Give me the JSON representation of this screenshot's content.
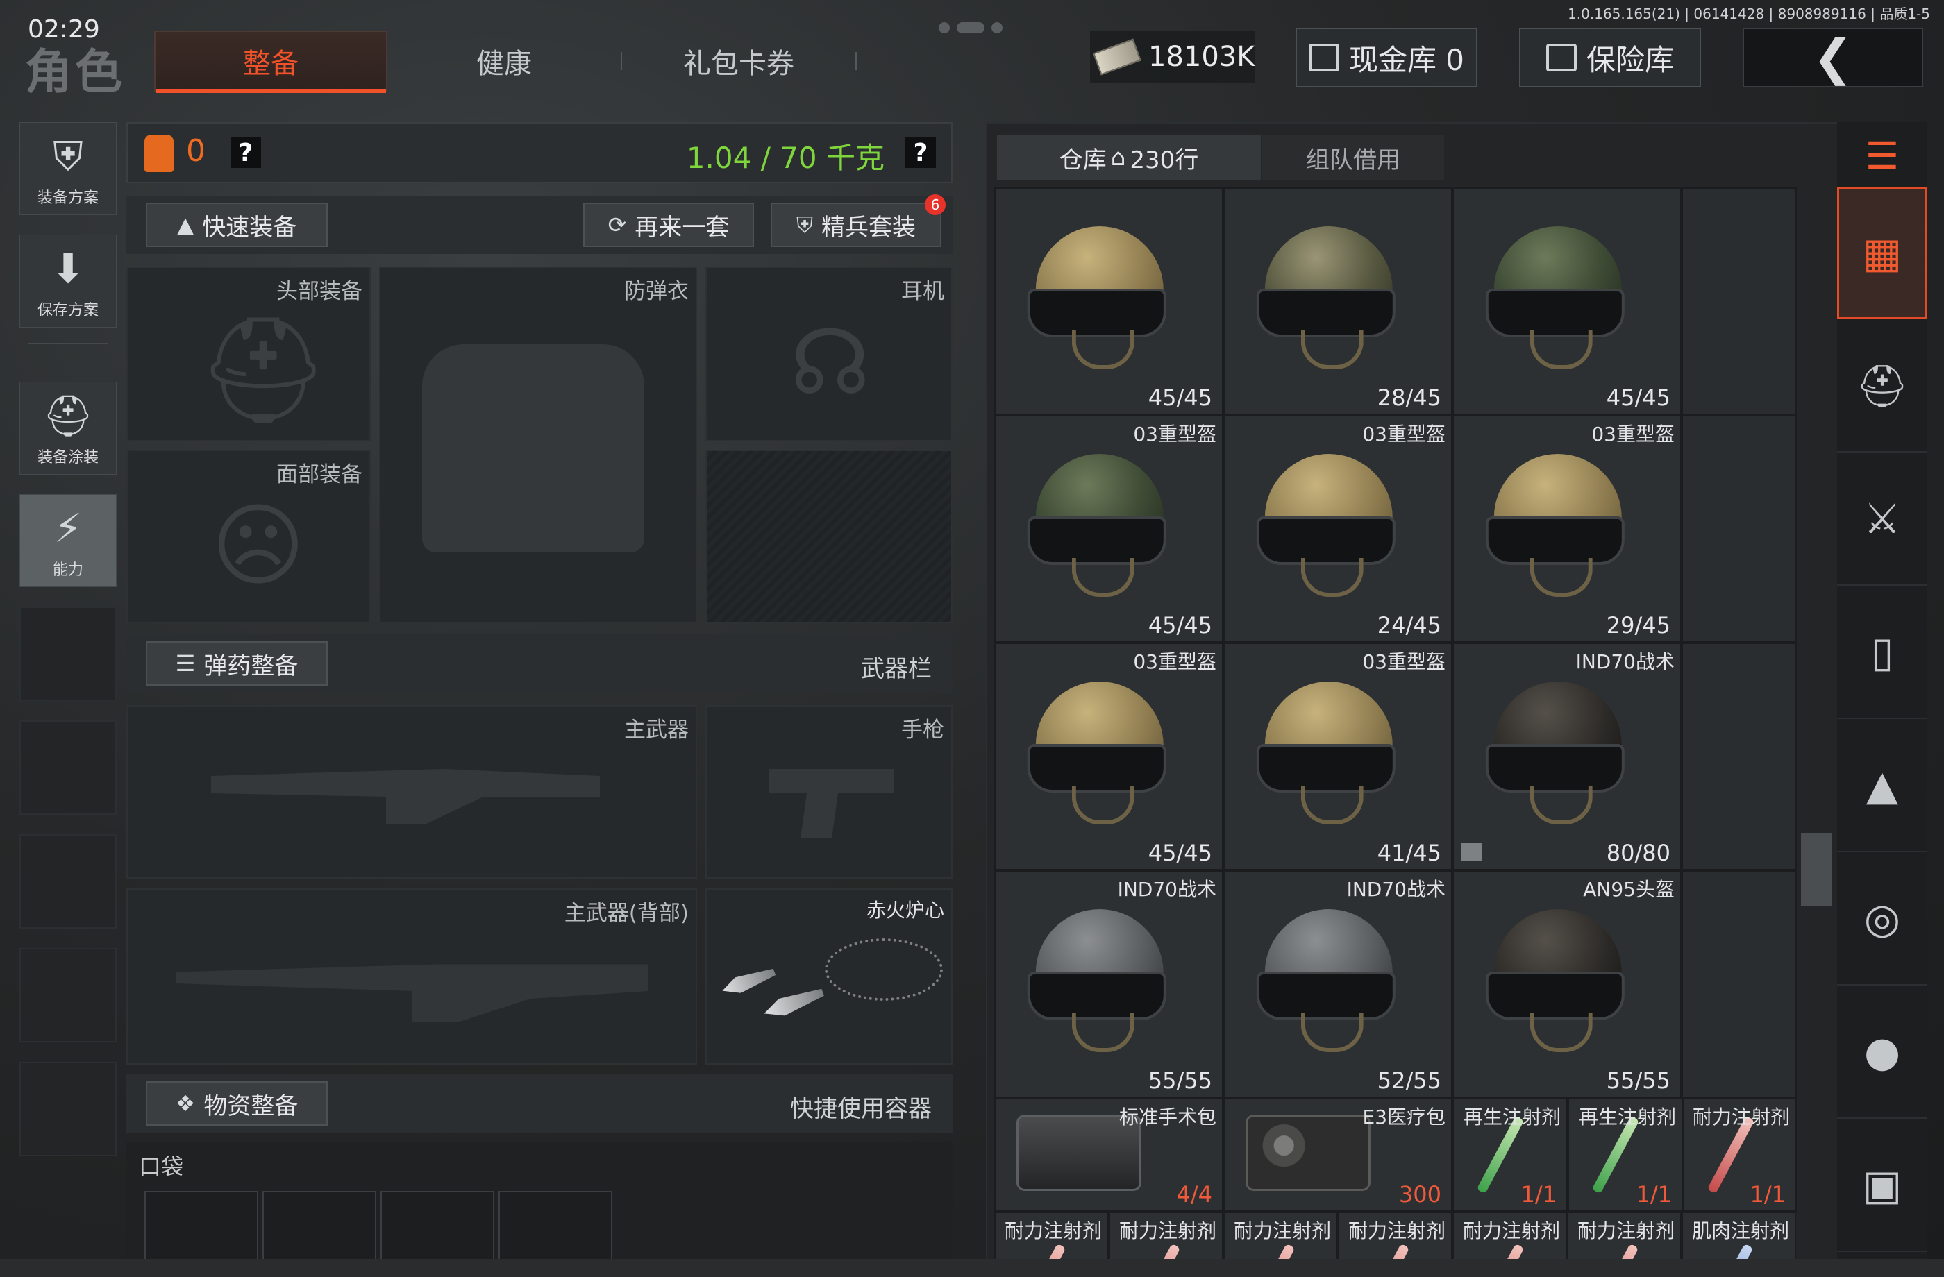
{
  "status": {
    "time": "02:29",
    "version": "1.0.165.165(21) | 06141428 | 8908989116 | 品质1-5"
  },
  "page_title": "角色",
  "tabs": [
    {
      "label": "整备",
      "active": true
    },
    {
      "label": "健康",
      "active": false
    },
    {
      "label": "礼包卡券",
      "active": false
    }
  ],
  "currency": {
    "amount": "18103K",
    "icon": "cash-bundle-icon"
  },
  "top_buttons": {
    "cash_vault": "现金库 0",
    "safe_box": "保险库"
  },
  "sidebar": [
    {
      "label": "装备方案",
      "icon": "vest-icon"
    },
    {
      "label": "保存方案",
      "icon": "download-icon"
    },
    {
      "label": "装备涂装",
      "icon": "helmet-paint-icon"
    },
    {
      "label": "能力",
      "icon": "lightning-hex-icon"
    }
  ],
  "loadout": {
    "backpack_count": "0",
    "help": "?",
    "weight": "1.04 / 70 千克",
    "quick_equip": "快速装备",
    "again": "再来一套",
    "elite_set": "精兵套装",
    "elite_badge": "6",
    "slots": {
      "head": "头部装备",
      "armor": "防弹衣",
      "headset": "耳机",
      "face": "面部装备",
      "primary": "主武器",
      "pistol": "手枪",
      "primary_back": "主武器(背部)",
      "melee": "赤火炉心"
    },
    "ammo_equip": "弹药整备",
    "weapon_bar": "武器栏",
    "supply_equip": "物资整备",
    "quick_container": "快捷使用容器",
    "pocket": "口袋"
  },
  "warehouse": {
    "tab_label": "仓库",
    "tab_rows": "230行",
    "team_borrow": "组队借用",
    "items": [
      {
        "name": "",
        "dur": "45/45",
        "color": "c-tan"
      },
      {
        "name": "",
        "dur": "28/45",
        "color": "c-camo"
      },
      {
        "name": "",
        "dur": "45/45",
        "color": "c-green"
      },
      {
        "name": "03重型盔",
        "dur": "45/45",
        "color": "c-green"
      },
      {
        "name": "03重型盔",
        "dur": "24/45",
        "color": "c-tan"
      },
      {
        "name": "03重型盔",
        "dur": "29/45",
        "color": "c-tan"
      },
      {
        "name": "03重型盔",
        "dur": "45/45",
        "color": "c-tan"
      },
      {
        "name": "03重型盔",
        "dur": "41/45",
        "color": "c-tan"
      },
      {
        "name": "IND70战术",
        "dur": "80/80",
        "color": "c-dark"
      },
      {
        "name": "IND70战术",
        "dur": "55/55",
        "color": "c-grey"
      },
      {
        "name": "IND70战术",
        "dur": "52/55",
        "color": "c-grey"
      },
      {
        "name": "AN95头盔",
        "dur": "55/55",
        "color": "c-dark"
      }
    ],
    "meds_row": [
      {
        "name": "标准手术包",
        "qty": "4/4",
        "kind": "kit-black"
      },
      {
        "name": "E3医疗包",
        "qty": "300",
        "kind": "kit-camo"
      },
      {
        "name": "再生注射剂",
        "qty": "1/1",
        "kind": "green"
      },
      {
        "name": "再生注射剂",
        "qty": "1/1",
        "kind": "green"
      },
      {
        "name": "耐力注射剂",
        "qty": "1/1",
        "kind": "red"
      }
    ],
    "bottom_row": [
      "耐力注射剂",
      "耐力注射剂",
      "耐力注射剂",
      "耐力注射剂",
      "耐力注射剂",
      "耐力注射剂",
      "肌肉注射剂"
    ]
  },
  "rail": [
    "sort-refresh-icon",
    "all-items-icon",
    "helmet-icon",
    "rifle-icon",
    "magazine-icon",
    "ammo-icon",
    "scope-icon",
    "grenade-icon",
    "misc-icon"
  ],
  "colors": {
    "accent": "#f2522a",
    "weight": "#7fd63c",
    "badge": "#e8332b"
  }
}
